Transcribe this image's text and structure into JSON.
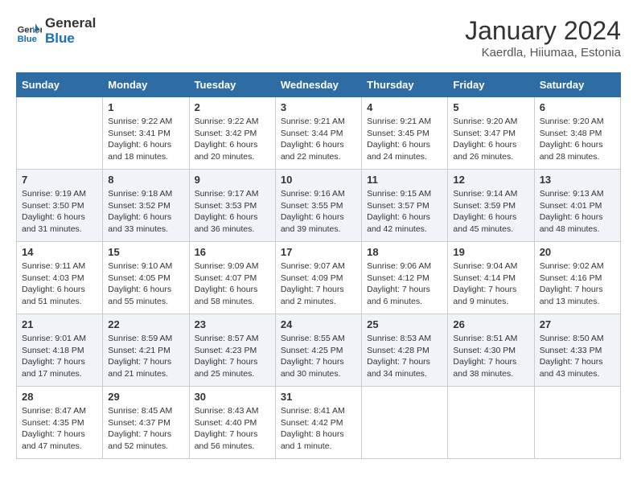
{
  "header": {
    "logo_general": "General",
    "logo_blue": "Blue",
    "month_year": "January 2024",
    "location": "Kaerdla, Hiiumaa, Estonia"
  },
  "days_of_week": [
    "Sunday",
    "Monday",
    "Tuesday",
    "Wednesday",
    "Thursday",
    "Friday",
    "Saturday"
  ],
  "weeks": [
    [
      {
        "num": "",
        "info": ""
      },
      {
        "num": "1",
        "info": "Sunrise: 9:22 AM\nSunset: 3:41 PM\nDaylight: 6 hours\nand 18 minutes."
      },
      {
        "num": "2",
        "info": "Sunrise: 9:22 AM\nSunset: 3:42 PM\nDaylight: 6 hours\nand 20 minutes."
      },
      {
        "num": "3",
        "info": "Sunrise: 9:21 AM\nSunset: 3:44 PM\nDaylight: 6 hours\nand 22 minutes."
      },
      {
        "num": "4",
        "info": "Sunrise: 9:21 AM\nSunset: 3:45 PM\nDaylight: 6 hours\nand 24 minutes."
      },
      {
        "num": "5",
        "info": "Sunrise: 9:20 AM\nSunset: 3:47 PM\nDaylight: 6 hours\nand 26 minutes."
      },
      {
        "num": "6",
        "info": "Sunrise: 9:20 AM\nSunset: 3:48 PM\nDaylight: 6 hours\nand 28 minutes."
      }
    ],
    [
      {
        "num": "7",
        "info": "Sunrise: 9:19 AM\nSunset: 3:50 PM\nDaylight: 6 hours\nand 31 minutes."
      },
      {
        "num": "8",
        "info": "Sunrise: 9:18 AM\nSunset: 3:52 PM\nDaylight: 6 hours\nand 33 minutes."
      },
      {
        "num": "9",
        "info": "Sunrise: 9:17 AM\nSunset: 3:53 PM\nDaylight: 6 hours\nand 36 minutes."
      },
      {
        "num": "10",
        "info": "Sunrise: 9:16 AM\nSunset: 3:55 PM\nDaylight: 6 hours\nand 39 minutes."
      },
      {
        "num": "11",
        "info": "Sunrise: 9:15 AM\nSunset: 3:57 PM\nDaylight: 6 hours\nand 42 minutes."
      },
      {
        "num": "12",
        "info": "Sunrise: 9:14 AM\nSunset: 3:59 PM\nDaylight: 6 hours\nand 45 minutes."
      },
      {
        "num": "13",
        "info": "Sunrise: 9:13 AM\nSunset: 4:01 PM\nDaylight: 6 hours\nand 48 minutes."
      }
    ],
    [
      {
        "num": "14",
        "info": "Sunrise: 9:11 AM\nSunset: 4:03 PM\nDaylight: 6 hours\nand 51 minutes."
      },
      {
        "num": "15",
        "info": "Sunrise: 9:10 AM\nSunset: 4:05 PM\nDaylight: 6 hours\nand 55 minutes."
      },
      {
        "num": "16",
        "info": "Sunrise: 9:09 AM\nSunset: 4:07 PM\nDaylight: 6 hours\nand 58 minutes."
      },
      {
        "num": "17",
        "info": "Sunrise: 9:07 AM\nSunset: 4:09 PM\nDaylight: 7 hours\nand 2 minutes."
      },
      {
        "num": "18",
        "info": "Sunrise: 9:06 AM\nSunset: 4:12 PM\nDaylight: 7 hours\nand 6 minutes."
      },
      {
        "num": "19",
        "info": "Sunrise: 9:04 AM\nSunset: 4:14 PM\nDaylight: 7 hours\nand 9 minutes."
      },
      {
        "num": "20",
        "info": "Sunrise: 9:02 AM\nSunset: 4:16 PM\nDaylight: 7 hours\nand 13 minutes."
      }
    ],
    [
      {
        "num": "21",
        "info": "Sunrise: 9:01 AM\nSunset: 4:18 PM\nDaylight: 7 hours\nand 17 minutes."
      },
      {
        "num": "22",
        "info": "Sunrise: 8:59 AM\nSunset: 4:21 PM\nDaylight: 7 hours\nand 21 minutes."
      },
      {
        "num": "23",
        "info": "Sunrise: 8:57 AM\nSunset: 4:23 PM\nDaylight: 7 hours\nand 25 minutes."
      },
      {
        "num": "24",
        "info": "Sunrise: 8:55 AM\nSunset: 4:25 PM\nDaylight: 7 hours\nand 30 minutes."
      },
      {
        "num": "25",
        "info": "Sunrise: 8:53 AM\nSunset: 4:28 PM\nDaylight: 7 hours\nand 34 minutes."
      },
      {
        "num": "26",
        "info": "Sunrise: 8:51 AM\nSunset: 4:30 PM\nDaylight: 7 hours\nand 38 minutes."
      },
      {
        "num": "27",
        "info": "Sunrise: 8:50 AM\nSunset: 4:33 PM\nDaylight: 7 hours\nand 43 minutes."
      }
    ],
    [
      {
        "num": "28",
        "info": "Sunrise: 8:47 AM\nSunset: 4:35 PM\nDaylight: 7 hours\nand 47 minutes."
      },
      {
        "num": "29",
        "info": "Sunrise: 8:45 AM\nSunset: 4:37 PM\nDaylight: 7 hours\nand 52 minutes."
      },
      {
        "num": "30",
        "info": "Sunrise: 8:43 AM\nSunset: 4:40 PM\nDaylight: 7 hours\nand 56 minutes."
      },
      {
        "num": "31",
        "info": "Sunrise: 8:41 AM\nSunset: 4:42 PM\nDaylight: 8 hours\nand 1 minute."
      },
      {
        "num": "",
        "info": ""
      },
      {
        "num": "",
        "info": ""
      },
      {
        "num": "",
        "info": ""
      }
    ]
  ]
}
